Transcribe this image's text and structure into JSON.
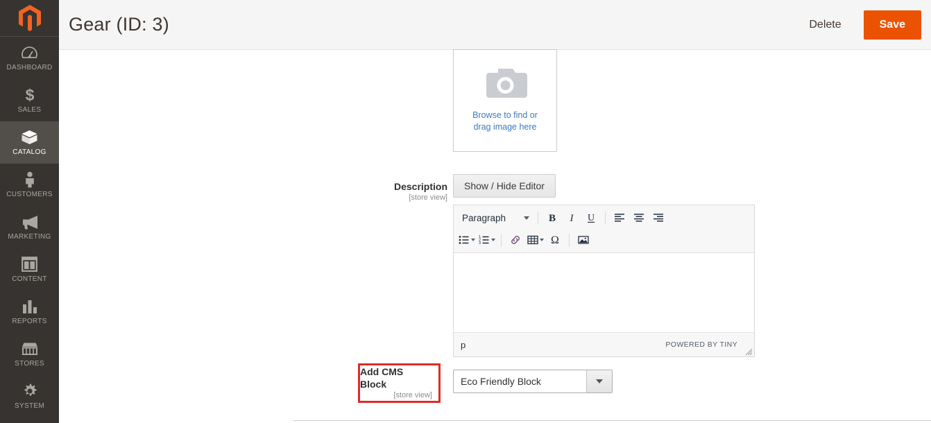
{
  "sidebar": {
    "logo_icon": "magento-logo-icon",
    "items": [
      {
        "label": "DASHBOARD",
        "icon": "dashboard-icon",
        "active": false
      },
      {
        "label": "SALES",
        "icon": "dollar-icon",
        "active": false
      },
      {
        "label": "CATALOG",
        "icon": "box-icon",
        "active": true
      },
      {
        "label": "CUSTOMERS",
        "icon": "person-icon",
        "active": false
      },
      {
        "label": "MARKETING",
        "icon": "megaphone-icon",
        "active": false
      },
      {
        "label": "CONTENT",
        "icon": "layout-icon",
        "active": false
      },
      {
        "label": "REPORTS",
        "icon": "bar-chart-icon",
        "active": false
      },
      {
        "label": "STORES",
        "icon": "storefront-icon",
        "active": false
      },
      {
        "label": "SYSTEM",
        "icon": "gear-icon",
        "active": false
      }
    ]
  },
  "header": {
    "title": "Gear (ID: 3)",
    "delete_label": "Delete",
    "save_label": "Save",
    "save_color": "#eb5202"
  },
  "image_uploader": {
    "icon": "camera-icon",
    "line1": "Browse to find or",
    "line2": "drag image here",
    "link_color": "#3b7bbf"
  },
  "description_field": {
    "label": "Description",
    "scope": "[store view]",
    "toggle_editor_label": "Show / Hide Editor"
  },
  "editor": {
    "format_select": "Paragraph",
    "toolbar_row1": [
      {
        "name": "bold-icon",
        "label": "B"
      },
      {
        "name": "italic-icon",
        "label": "I"
      },
      {
        "name": "underline-icon",
        "label": "U"
      },
      {
        "name": "align-left-icon",
        "label": ""
      },
      {
        "name": "align-center-icon",
        "label": ""
      },
      {
        "name": "align-right-icon",
        "label": ""
      }
    ],
    "toolbar_row2": [
      {
        "name": "bullet-list-icon",
        "label": ""
      },
      {
        "name": "numbered-list-icon",
        "label": ""
      },
      {
        "name": "link-icon",
        "label": ""
      },
      {
        "name": "table-icon",
        "label": ""
      },
      {
        "name": "special-character-icon",
        "label": "Ω"
      },
      {
        "name": "insert-image-icon",
        "label": ""
      }
    ],
    "content": "",
    "status_path": "p",
    "status_brand": "POWERED BY TINY"
  },
  "cms_block_field": {
    "label": "Add CMS Block",
    "scope": "[store view]",
    "selected_option": "Eco Friendly Block",
    "highlight_color": "#e02b27"
  }
}
